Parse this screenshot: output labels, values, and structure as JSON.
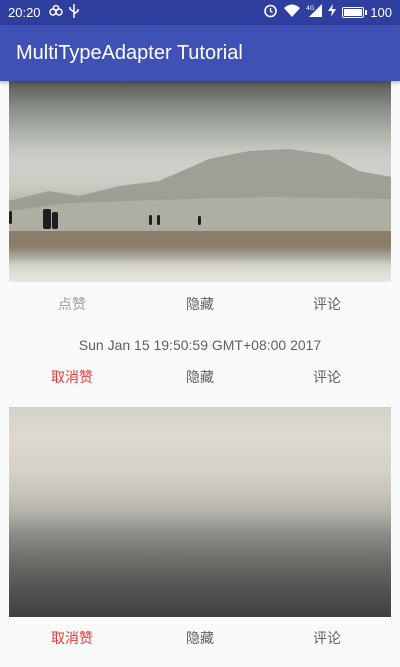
{
  "status_bar": {
    "time": "20:20",
    "battery_level": "100",
    "icons": [
      "weibo-icon",
      "usb-icon",
      "alarm-icon",
      "wifi-icon",
      "signal-4g-icon",
      "charging-icon",
      "battery-icon"
    ]
  },
  "app_bar": {
    "title": "MultiTypeAdapter Tutorial",
    "color": "#3f51b5"
  },
  "feed": {
    "item1": {
      "like_label": "点赞",
      "hide_label": "隐藏",
      "comment_label": "评论"
    },
    "item2": {
      "date": "Sun Jan 15 19:50:59 GMT+08:00 2017",
      "like_label": "取消赞",
      "hide_label": "隐藏",
      "comment_label": "评论"
    },
    "item3": {
      "like_label": "取消赞",
      "hide_label": "隐藏",
      "comment_label": "评论"
    }
  },
  "colors": {
    "liked": "#e53935",
    "unliked": "#9e9e9e",
    "action_text": "#616161"
  }
}
